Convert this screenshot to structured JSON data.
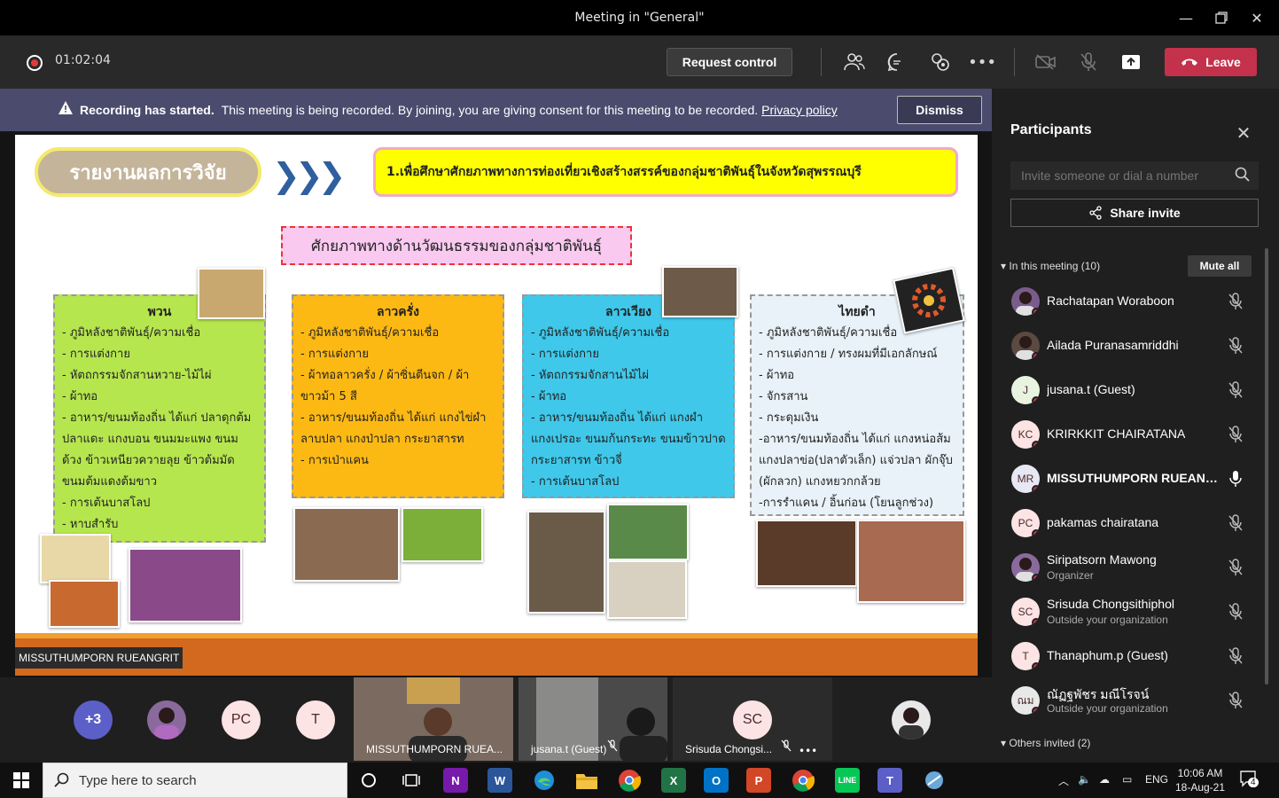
{
  "window": {
    "title": "Meeting in \"General\""
  },
  "toolbar": {
    "timer": "01:02:04",
    "request_control": "Request control",
    "leave": "Leave"
  },
  "banner": {
    "bold": "Recording has started.",
    "message": "This meeting is being recorded. By joining, you are giving consent for this meeting to be recorded.",
    "link": "Privacy policy",
    "dismiss": "Dismiss"
  },
  "slide": {
    "title": "รายงานผลการวิจัย",
    "objective": "1.เพื่อศึกษาศักยภาพทางการท่องเที่ยวเชิงสร้างสรรค์ของกลุ่มชาติพันธุ์ในจังหวัดสุพรรณบุรี",
    "subhead": "ศักยภาพทางด้านวัฒนธรรมของกลุ่มชาติพันธุ์",
    "cards": [
      {
        "title": "พวน",
        "items": [
          "- ภูมิหลังชาติพันธุ์/ความเชื่อ",
          "- การแต่งกาย",
          "- หัตถกรรมจักสานหวาย-ไม้ไผ่",
          "- ผ้าทอ",
          "- อาหาร/ขนมท้องถิ่น ได้แก่ ปลาดุกต้มปลาแดะ  แกงบอน ขนมมะแพง ขนมด้วง  ข้าวเหนียวควายลุย ข้าวต้มมัด ขนมต้มแดงต้มขาว",
          "- การเต้นบาสโลป",
          "- หาบสำรับ"
        ]
      },
      {
        "title": "ลาวครั่ง",
        "items": [
          "- ภูมิหลังชาติพันธุ์/ความเชื่อ",
          "- การแต่งกาย",
          "- ผ้าทอลาวครั่ง / ผ้าซิ่นตีนจก / ผ้าขาวม้า 5 สี",
          "-     อาหาร/ขนมท้องถิ่น ได้แก่ แกงไข่ผำ ลาบปลา แกงป่าปลา กระยาสารท",
          "- การเป่าแคน"
        ]
      },
      {
        "title": "ลาวเวียง",
        "items": [
          "- ภูมิหลังชาติพันธุ์/ความเชื่อ",
          "- การแต่งกาย",
          "- หัตถกรรมจักสานไม้ไผ่",
          "- ผ้าทอ",
          "- อาหาร/ขนมท้องถิ่น ได้แก่ แกงผำ แกงเปรอะ ขนมก้นกระทะ ขนมข้าวปาด กระยาสารท ข้าวจี่",
          "- การเต้นบาสโลป"
        ]
      },
      {
        "title": "ไทยดำ",
        "items": [
          "- ภูมิหลังชาติพันธุ์/ความเชื่อ",
          "- การแต่งกาย / ทรงผมที่มีเอกลักษณ์",
          "- ผ้าทอ",
          "- จักรสาน",
          "- กระดุมเงิน",
          "-อาหาร/ขนมท้องถิ่น ได้แก่ แกงหน่อส้ม แกงปลาข่อ(ปลาตัวเล็ก) แจ่วปลา ผักจุ๊บ (ผักลวก) แกงหยวกกล้วย",
          "-การรำแคน / อิ้นก่อน (โยนลูกช่วง)"
        ]
      }
    ]
  },
  "presenter_tag": "MISSUTHUMPORN RUEANGRIT",
  "strip": {
    "overflow": "+3",
    "tiles": [
      {
        "initials": "PC"
      },
      {
        "initials": "T"
      },
      {
        "label": "MISSUTHUMPORN RUEA..."
      },
      {
        "label": "jusana.t (Guest)"
      },
      {
        "initials": "SC",
        "label": "Srisuda Chongsi..."
      }
    ]
  },
  "panel": {
    "title": "Participants",
    "invite_placeholder": "Invite someone or dial a number",
    "share_invite": "Share invite",
    "in_meeting": "In this meeting (10)",
    "mute_all": "Mute all",
    "others_invited": "Others invited (2)",
    "participants": [
      {
        "name": "Rachatapan Woraboon",
        "initials": "",
        "sub": "",
        "color": "#7a5c8c"
      },
      {
        "name": "Ailada Puranasamriddhi",
        "initials": "",
        "sub": "",
        "color": "#5a4a40"
      },
      {
        "name": "jusana.t (Guest)",
        "initials": "J",
        "sub": "",
        "color": "#e8f3e0"
      },
      {
        "name": "KRIRKKIT CHAIRATANA",
        "initials": "KC",
        "sub": "",
        "color": "#fce4e4"
      },
      {
        "name": "MISSUTHUMPORN RUEANG...",
        "initials": "MR",
        "sub": "",
        "color": "#e8e8f4"
      },
      {
        "name": "pakamas chairatana",
        "initials": "PC",
        "sub": "",
        "color": "#fce4e4"
      },
      {
        "name": "Siripatsorn Mawong",
        "initials": "",
        "sub": "Organizer",
        "color": "#8a6a9c"
      },
      {
        "name": "Srisuda Chongsithiphol",
        "initials": "SC",
        "sub": "Outside your organization",
        "color": "#fce4e4"
      },
      {
        "name": "Thanaphum.p (Guest)",
        "initials": "T",
        "sub": "",
        "color": "#fce4e4"
      },
      {
        "name": "ณัฏฐพัชร มณีโรจน์",
        "initials": "ณม",
        "sub": "Outside your organization",
        "color": "#e8e8e8"
      }
    ]
  },
  "taskbar": {
    "search_placeholder": "Type here to search",
    "lang": "ENG",
    "time": "10:06 AM",
    "date": "18-Aug-21",
    "notifications": "4"
  },
  "colors": {
    "accent": "#7f85f5",
    "leave": "#c4314b",
    "banner": "#4b4b6e"
  }
}
